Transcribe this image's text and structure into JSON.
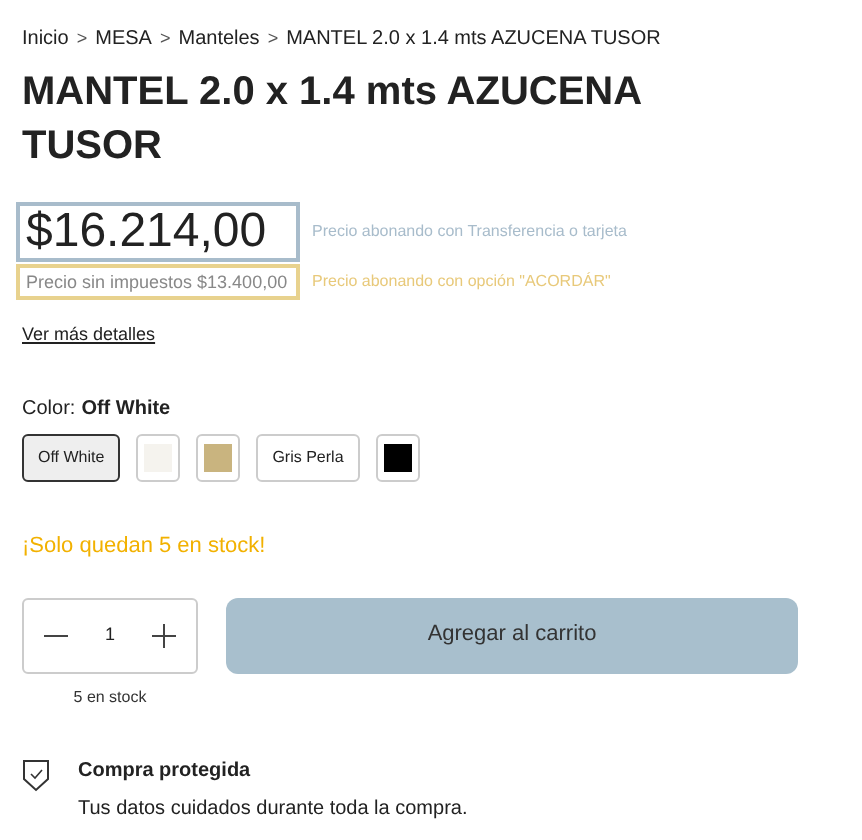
{
  "breadcrumb": [
    {
      "kind": "link",
      "text": "Inicio"
    },
    {
      "kind": "separator",
      "text": ">"
    },
    {
      "kind": "link",
      "text": "MESA"
    },
    {
      "kind": "separator",
      "text": ">"
    },
    {
      "kind": "link",
      "text": "Manteles"
    },
    {
      "kind": "separator",
      "text": ">"
    },
    {
      "kind": "link",
      "text": "MANTEL 2.0 x 1.4 mts AZUCENA TUSOR"
    }
  ],
  "title": "MANTEL 2.0 x 1.4 mts AZUCENA TUSOR",
  "price": "$16.214,00",
  "price_note": "Precio abonando con Transferencia o tarjeta",
  "price_no_tax": "Precio sin impuestos $13.400,00",
  "price_no_tax_note": "Precio abonando con opción \"ACORDÁR\"",
  "details_link": "Ver más detalles",
  "color_label": "Color:",
  "color_value": "Off White",
  "color_options": [
    {
      "kind": "text",
      "label": "Off White",
      "selected": true
    },
    {
      "kind": "swatch",
      "color": "#f5f3ee",
      "selected": false
    },
    {
      "kind": "swatch",
      "color": "#c9b47f",
      "selected": false
    },
    {
      "kind": "text",
      "label": "Gris Perla",
      "selected": false
    },
    {
      "kind": "swatch",
      "color": "#000000",
      "selected": false
    }
  ],
  "stock_alert": "¡Solo quedan 5 en stock!",
  "quantity": "1",
  "add_button": "Agregar al carrito",
  "stock_count": "5 en stock",
  "protection": {
    "title": "Compra protegida",
    "text": "Tus datos cuidados durante toda la compra."
  }
}
